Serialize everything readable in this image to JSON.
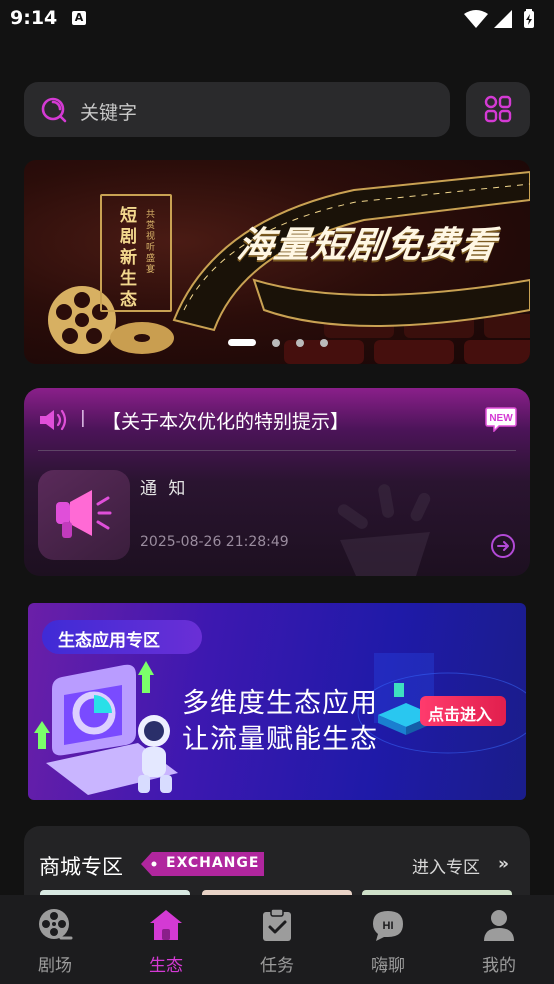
{
  "status_bar": {
    "time": "9:14",
    "notification_icon": "A"
  },
  "search": {
    "placeholder": "关键字",
    "icon": "search-icon"
  },
  "grid_button": {
    "icon": "grid-icon"
  },
  "banner": {
    "headline": "海量短剧免费看",
    "vertical_text": "短剧新生态",
    "vertical_small": "共赏视听盛宴",
    "dots_count": 4,
    "active_dot": 0
  },
  "notice": {
    "separator": "|",
    "title": "【关于本次优化的特别提示】",
    "badge": "NEW",
    "label": "通 知",
    "timestamp": "2025-08-26 21:28:49"
  },
  "eco_banner": {
    "tag": "生态应用专区",
    "line1": "多维度生态应用",
    "line2": "让流量赋能生态",
    "button": "点击进入"
  },
  "mall": {
    "title": "商城专区",
    "tag": "EXCHANGE",
    "enter_label": "进入专区",
    "enter_arrow": "»"
  },
  "tabs": [
    {
      "label": "剧场",
      "icon": "film-reel-icon",
      "active": false
    },
    {
      "label": "生态",
      "icon": "home-icon",
      "active": true
    },
    {
      "label": "任务",
      "icon": "clipboard-check-icon",
      "active": false
    },
    {
      "label": "嗨聊",
      "icon": "chat-hi-icon",
      "active": false
    },
    {
      "label": "我的",
      "icon": "user-icon",
      "active": false
    }
  ],
  "colors": {
    "accent": "#d43ad4",
    "background": "#121212",
    "card": "#2a2a2c"
  }
}
